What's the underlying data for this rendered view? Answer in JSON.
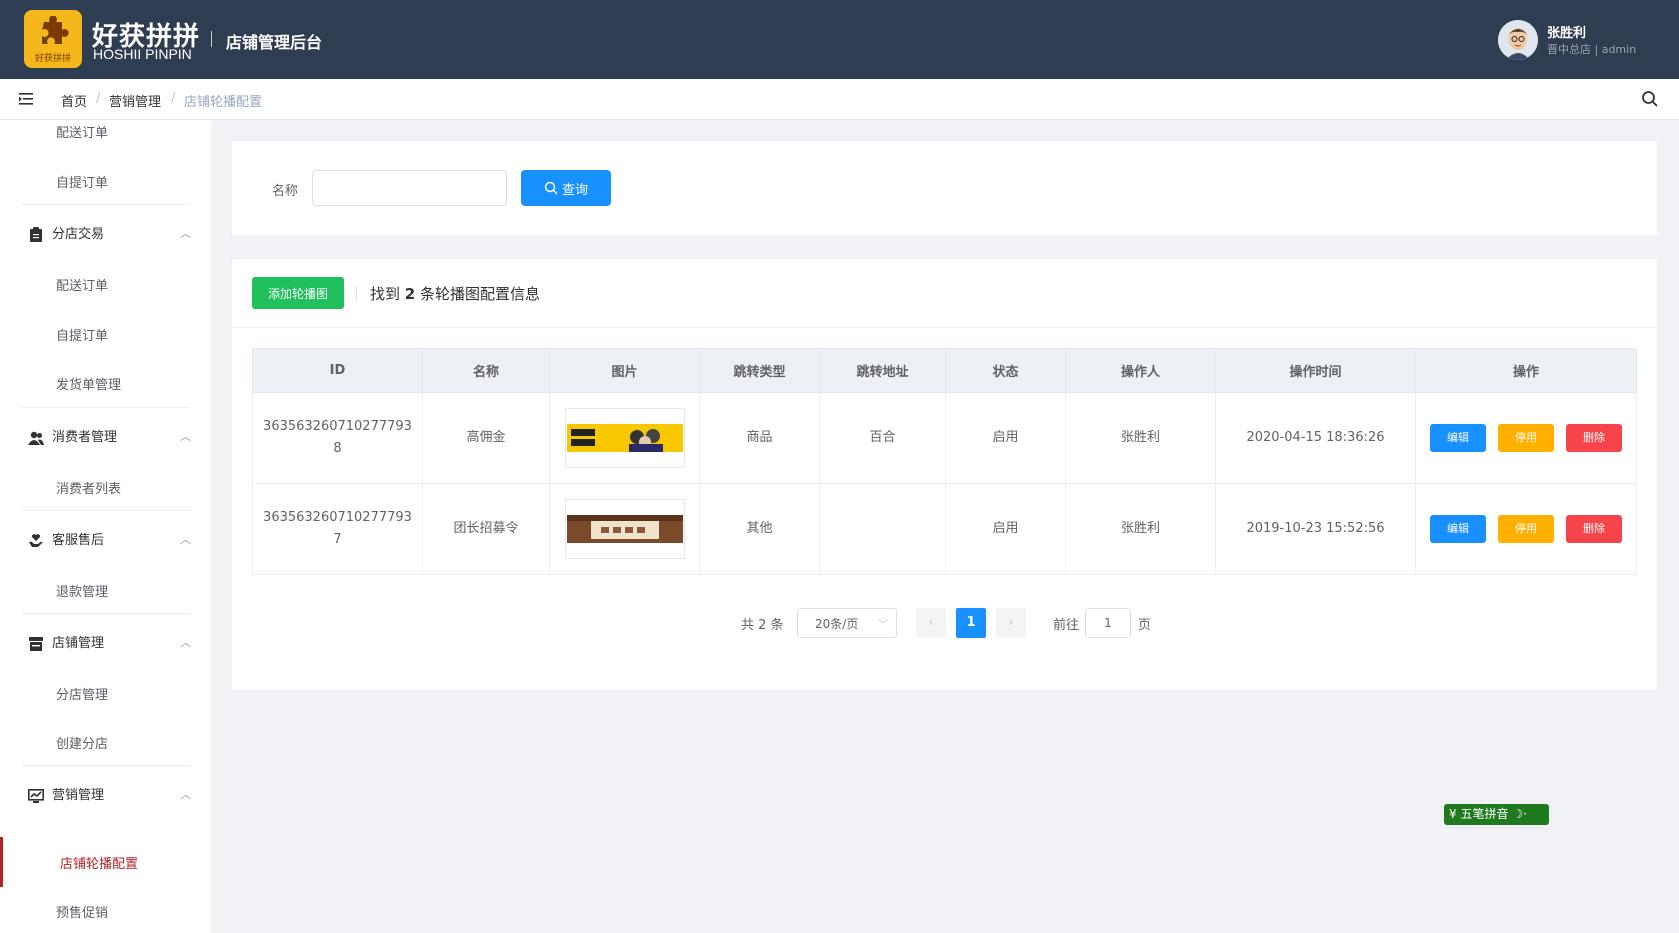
{
  "header": {
    "brand_cn": "好获拼拼",
    "brand_en": "HOSHII PINPIN",
    "logo_sub": "好获拼拼",
    "system_title": "店铺管理后台",
    "user_name": "张胜利",
    "user_sub": "晋中总店 | admin"
  },
  "breadcrumb": [
    "首页",
    "营销管理",
    "店铺轮播配置"
  ],
  "sidebar": {
    "items": [
      {
        "type": "sub",
        "label": "配送订单"
      },
      {
        "type": "sub",
        "label": "自提订单"
      },
      {
        "type": "group",
        "label": "分店交易",
        "icon": "clipboard-icon"
      },
      {
        "type": "sub",
        "label": "配送订单"
      },
      {
        "type": "sub",
        "label": "自提订单"
      },
      {
        "type": "sub",
        "label": "发货单管理"
      },
      {
        "type": "group",
        "label": "消费者管理",
        "icon": "users-icon"
      },
      {
        "type": "sub",
        "label": "消费者列表"
      },
      {
        "type": "group",
        "label": "客服售后",
        "icon": "heart-hand-icon"
      },
      {
        "type": "sub",
        "label": "退款管理"
      },
      {
        "type": "group",
        "label": "店铺管理",
        "icon": "store-icon"
      },
      {
        "type": "sub",
        "label": "分店管理"
      },
      {
        "type": "sub",
        "label": "创建分店"
      },
      {
        "type": "group",
        "label": "营销管理",
        "icon": "chart-board-icon"
      },
      {
        "type": "sub",
        "label": "店铺轮播配置",
        "active": true
      },
      {
        "type": "sub",
        "label": "预售促销"
      }
    ]
  },
  "filter": {
    "name_label": "名称",
    "name_value": "",
    "query_label": "查询"
  },
  "result": {
    "add_label": "添加轮播图",
    "found_prefix": "找到",
    "found_count": "2",
    "found_suffix": "条轮播图配置信息"
  },
  "table": {
    "columns": [
      "ID",
      "名称",
      "图片",
      "跳转类型",
      "跳转地址",
      "状态",
      "操作人",
      "操作时间",
      "操作"
    ],
    "rows": [
      {
        "id": "3635632607102777938",
        "name": "高佣金",
        "jump_type": "商品",
        "jump_addr": "百合",
        "status": "启用",
        "operator": "张胜利",
        "time": "2020-04-15 18:36:26"
      },
      {
        "id": "3635632607102777937",
        "name": "团长招募令",
        "jump_type": "其他",
        "jump_addr": "",
        "status": "启用",
        "operator": "张胜利",
        "time": "2019-10-23 15:52:56"
      }
    ],
    "ops": {
      "edit": "编辑",
      "disable": "停用",
      "delete": "删除"
    }
  },
  "pager": {
    "total": "共 2 条",
    "page_size": "20条/页",
    "current": "1",
    "goto_label": "前往",
    "goto_value": "1",
    "page_unit": "页"
  },
  "ime": {
    "label": "五笔拼音"
  },
  "colors": {
    "header_bg": "#2f3d52",
    "primary": "#1890ff",
    "success": "#20c05c",
    "warning": "#ffb000",
    "danger": "#f5444a",
    "sidebar_active": "#b4232a",
    "logo": "#f5b81c"
  }
}
